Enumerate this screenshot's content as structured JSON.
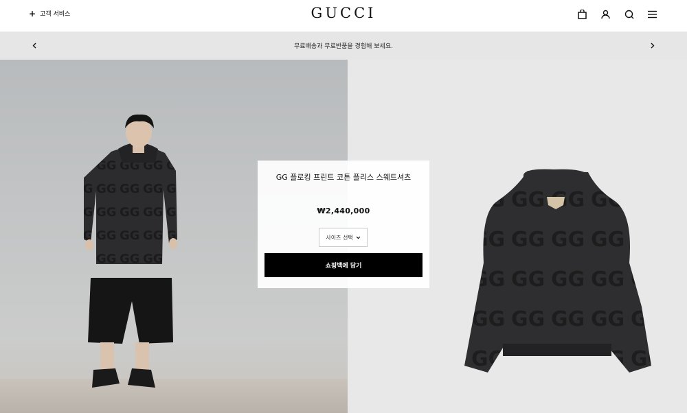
{
  "header": {
    "customer_service_label": "고객 서비스",
    "logo": "GUCCI",
    "icons": [
      "shopping-bag-icon",
      "user-icon",
      "search-icon",
      "menu-icon"
    ]
  },
  "promo": {
    "text": "무료배송과 무료반품을 경험해 보세요."
  },
  "product": {
    "name": "GG 플로킹 프린트 코튼 플리스 스웨트셔츠",
    "price": "₩2,440,000",
    "size_select": "사이즈 선택",
    "add_to_cart": "쇼핑백에 담기"
  },
  "colors": {
    "header_bg": "#ffffff",
    "promo_bg": "#e6e6e6",
    "button_bg": "#000000",
    "right_panel_bg": "#e8e8e8"
  }
}
